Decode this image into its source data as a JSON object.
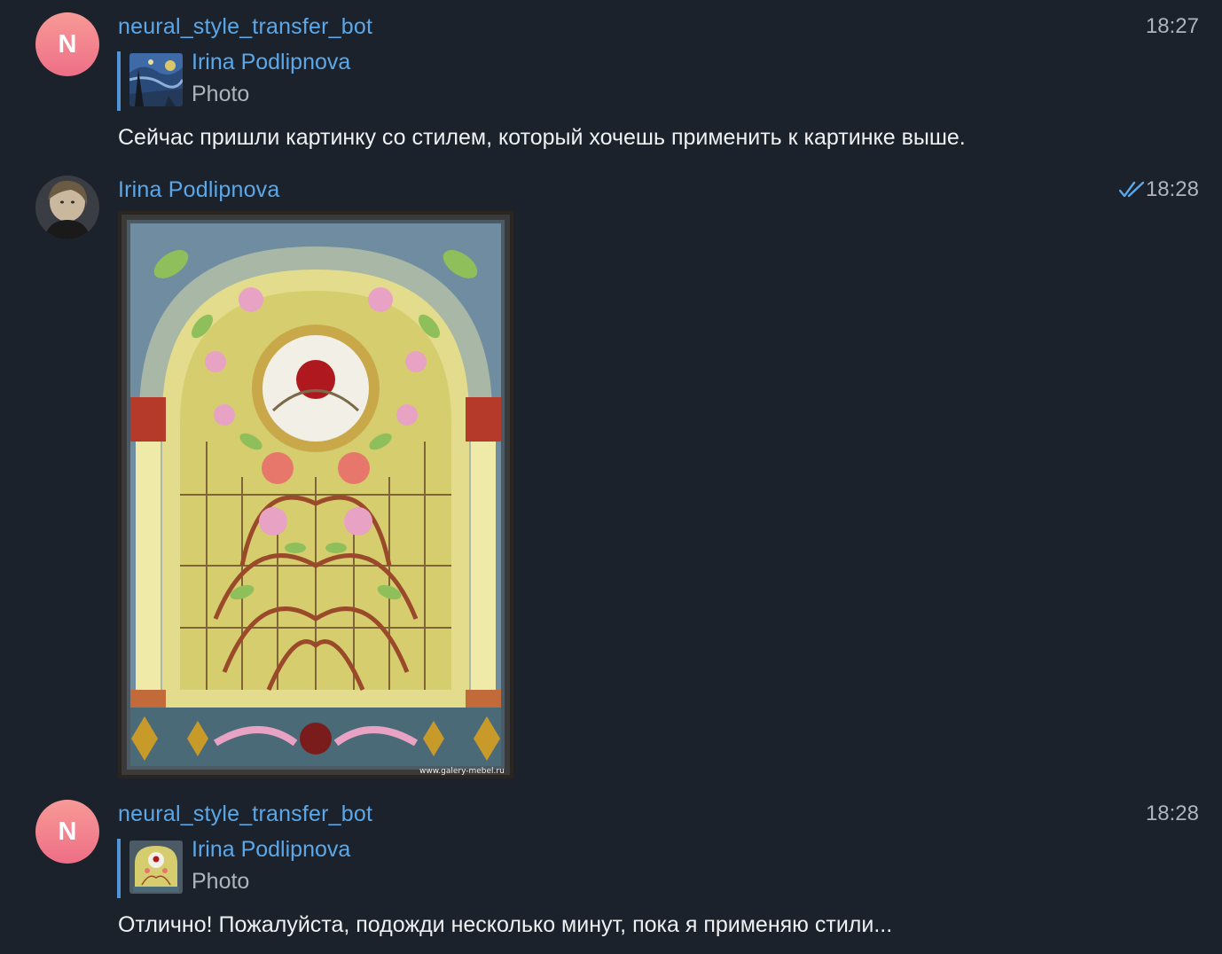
{
  "messages": [
    {
      "avatar_letter": "N",
      "sender": "neural_style_transfer_bot",
      "time": "18:27",
      "reply": {
        "name": "Irina Podlipnova",
        "text": "Photo",
        "thumb_icon": "starry-night-thumbnail"
      },
      "text": "Сейчас пришли картинку со стилем, который хочешь применить к картинке выше."
    },
    {
      "sender": "Irina Podlipnova",
      "time": "18:28",
      "status_icon": "double-check-icon",
      "photo": {
        "watermark": "www.galery-mebel.ru",
        "icon": "stained-glass-photo"
      }
    },
    {
      "avatar_letter": "N",
      "sender": "neural_style_transfer_bot",
      "time": "18:28",
      "reply": {
        "name": "Irina Podlipnova",
        "text": "Photo",
        "thumb_icon": "stained-glass-thumbnail"
      },
      "text": "Отлично! Пожалуйста, подожди несколько минут, пока я применяю стили..."
    }
  ],
  "colors": {
    "background": "#1c222b",
    "name_blue": "#5aa8ea",
    "reply_bar": "#4f95d8",
    "avatar_gradient": [
      "#f79a97",
      "#ee6f86"
    ],
    "muted": "#aeb4bb"
  }
}
